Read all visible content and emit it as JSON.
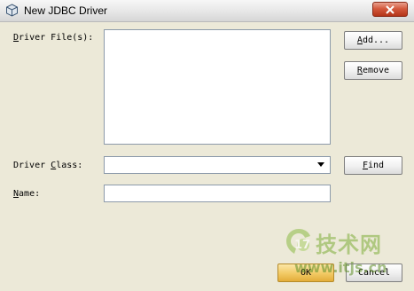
{
  "window": {
    "title": "New JDBC Driver",
    "close_icon": "close-icon"
  },
  "form": {
    "driver_files_label": "Driver File(s):",
    "driver_class_label": "Driver Class:",
    "name_label": "Name:",
    "driver_class_value": "",
    "name_value": ""
  },
  "buttons": {
    "add": "Add...",
    "remove": "Remove",
    "find": "Find",
    "ok": "OK",
    "cancel": "Cancel"
  },
  "watermark": {
    "logo_text": "技术网",
    "url": "www.itjs.cn"
  }
}
